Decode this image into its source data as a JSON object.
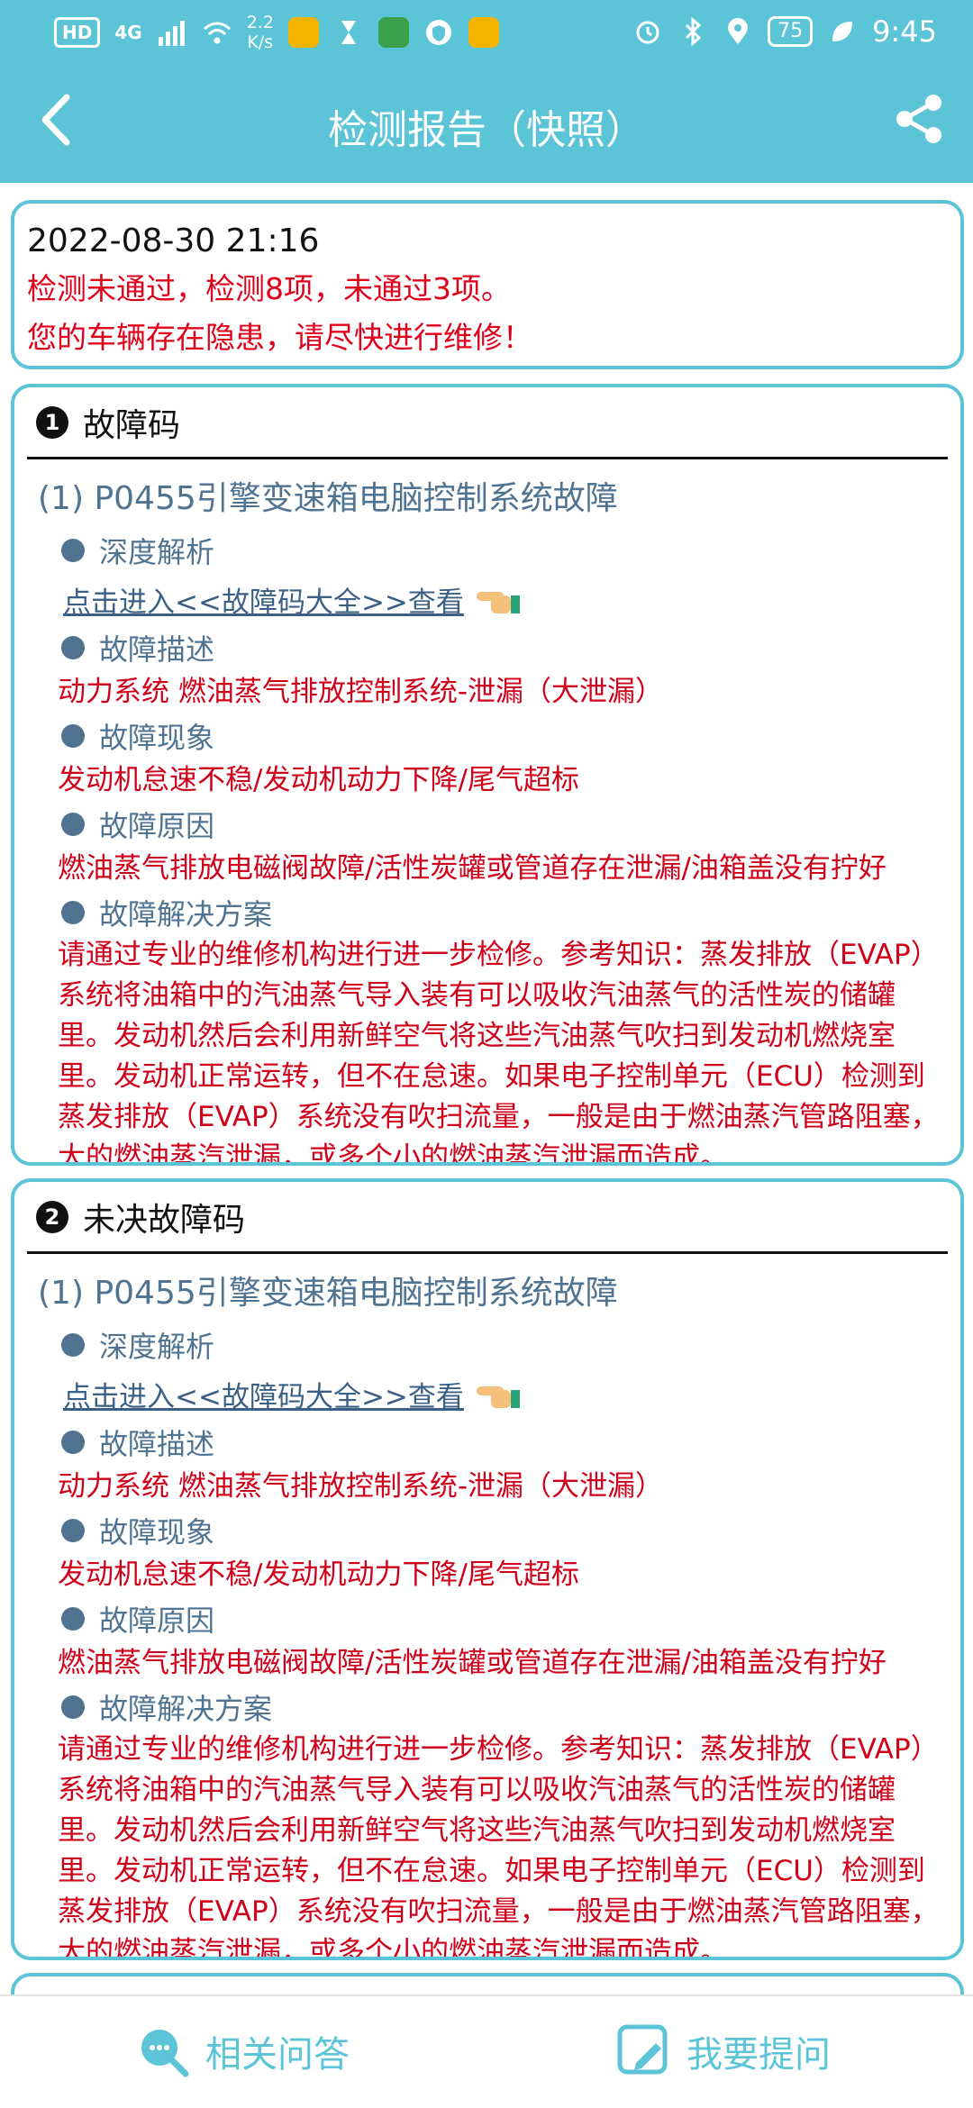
{
  "status_bar": {
    "hd": "HD",
    "network": "4G",
    "speed_value": "2.2",
    "speed_unit": "K/s",
    "battery": "75",
    "time": "9:45"
  },
  "header": {
    "title": "检测报告（快照）"
  },
  "summary": {
    "datetime": "2022-08-30 21:16",
    "result": "检测未通过，检测8项，未通过3项。",
    "advice": "您的车辆存在隐患，请尽快进行维修！"
  },
  "sections": [
    {
      "number": "1",
      "title": "故障码",
      "code_title": "(1) P0455引擎变速箱电脑控制系统故障",
      "deep_label": "深度解析",
      "link": "点击进入<<故障码大全>>查看",
      "desc_label": "故障描述",
      "desc": "动力系统 燃油蒸气排放控制系统-泄漏（大泄漏）",
      "symptom_label": "故障现象",
      "symptom": "发动机怠速不稳/发动机动力下降/尾气超标",
      "cause_label": "故障原因",
      "cause": "燃油蒸气排放电磁阀故障/活性炭罐或管道存在泄漏/油箱盖没有拧好",
      "solution_label": "故障解决方案",
      "solution_lines": [
        "请通过专业的维修机构进行进一步检修。参考知识：蒸发排放（EVAP）",
        "系统将油箱中的汽油蒸气导入装有可以吸收汽油蒸气的活性炭的储罐",
        "里。发动机然后会利用新鲜空气将这些汽油蒸气吹扫到发动机燃烧室",
        "里。发动机正常运转，但不在怠速。如果电子控制单元（ECU）检测到",
        "蒸发排放（EVAP）系统没有吹扫流量，一般是由于燃油蒸汽管路阻塞，",
        "大的燃油蒸汽泄漏，或多个小的燃油蒸汽泄漏而造成。"
      ]
    },
    {
      "number": "2",
      "title": "未决故障码",
      "code_title": "(1) P0455引擎变速箱电脑控制系统故障",
      "deep_label": "深度解析",
      "link": "点击进入<<故障码大全>>查看",
      "desc_label": "故障描述",
      "desc": "动力系统 燃油蒸气排放控制系统-泄漏（大泄漏）",
      "symptom_label": "故障现象",
      "symptom": "发动机怠速不稳/发动机动力下降/尾气超标",
      "cause_label": "故障原因",
      "cause": "燃油蒸气排放电磁阀故障/活性炭罐或管道存在泄漏/油箱盖没有拧好",
      "solution_label": "故障解决方案",
      "solution_lines": [
        "请通过专业的维修机构进行进一步检修。参考知识：蒸发排放（EVAP）",
        "系统将油箱中的汽油蒸气导入装有可以吸收汽油蒸气的活性炭的储罐",
        "里。发动机然后会利用新鲜空气将这些汽油蒸气吹扫到发动机燃烧室",
        "里。发动机正常运转，但不在怠速。如果电子控制单元（ECU）检测到",
        "蒸发排放（EVAP）系统没有吹扫流量，一般是由于燃油蒸汽管路阻塞，",
        "大的燃油蒸汽泄漏，或多个小的燃油蒸汽泄漏而造成。"
      ]
    }
  ],
  "bottom_bar": {
    "left_label": "相关问答",
    "right_label": "我要提问"
  },
  "colors": {
    "accent": "#5bc4d6",
    "warning": "#e0001a",
    "code_text": "#4f7391"
  }
}
